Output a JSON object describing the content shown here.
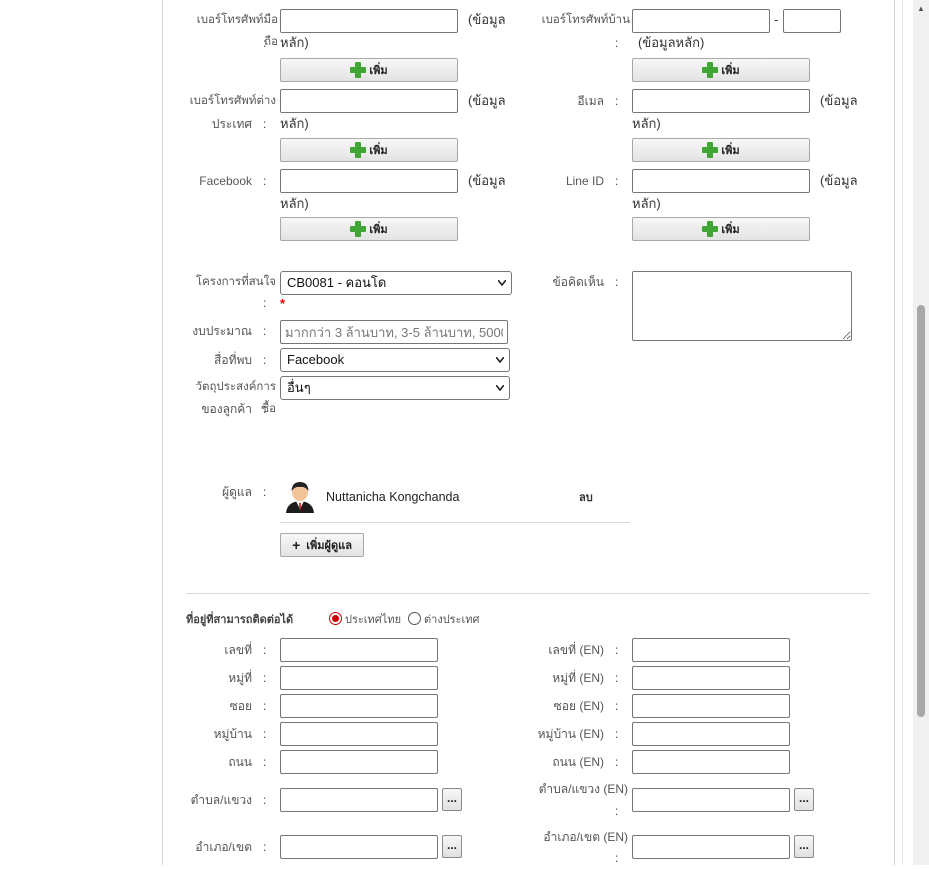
{
  "contact": {
    "mobile_label_1": "เบอร์โทรศัพท์มือถือ",
    "home_label": "เบอร์โทรศัพท์บ้าน",
    "intl_label_1": "เบอร์โทรศัพท์ต่าง",
    "intl_label_2": "ประเทศ",
    "email_label": "อีเมล",
    "facebook_label": "Facebook",
    "line_label": "Line ID",
    "primary_note_1": "(ข้อมูล",
    "primary_note_2": "หลัก)",
    "primary_note_full": "(ข้อมูลหลัก)",
    "phone_dash": "-",
    "add_label": "เพิ่ม",
    "colon": ":"
  },
  "interest": {
    "project_label": "โครงการที่สนใจ",
    "project_value": "CB0081 - คอนโด",
    "required_mark": "*",
    "budget_label": "งบประมาณ",
    "budget_placeholder": "มากกว่า 3 ล้านบาท, 3-5 ล้านบาท, 5000(",
    "source_label": "สื่อที่พบ",
    "source_value": "Facebook",
    "purpose_label_1": "วัตถุประสงค์การซื้อ",
    "purpose_label_2": "ของลูกค้า",
    "purpose_value": "อื่นๆ",
    "comment_label": "ข้อคิดเห็น"
  },
  "owner": {
    "label": "ผู้ดูแล",
    "name": "Nuttanicha Kongchanda",
    "delete_label": "ลบ",
    "add_owner_label": "เพิ่มผู้ดูแล"
  },
  "address": {
    "section_label": "ที่อยู่ที่สามารถติดต่อได้",
    "radio_thai": "ประเทศไทย",
    "radio_foreign": "ต่างประเทศ",
    "selected": "ประเทศไทย",
    "left_labels": [
      "เลขที่",
      "หมู่ที่",
      "ซอย",
      "หมู่บ้าน",
      "ถนน",
      "ตำบล/แขวง",
      "อำเภอ/เขต"
    ],
    "right_labels": [
      "เลขที่ (EN)",
      "หมู่ที่ (EN)",
      "ซอย (EN)",
      "หมู่บ้าน (EN)",
      "ถนน (EN)",
      "ตำบล/แขวง (EN)",
      "อำเภอ/เขต (EN)"
    ],
    "lookup_label": "..."
  },
  "colors": {
    "accent_plus": "#3fa535",
    "required": "#dd0000",
    "radio_on": "#cc0000"
  }
}
